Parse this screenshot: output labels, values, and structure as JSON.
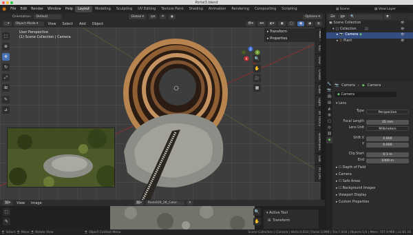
{
  "window": {
    "title": "Portal3.blend"
  },
  "topbar": {
    "menus": [
      "File",
      "Edit",
      "Render",
      "Window",
      "Help"
    ],
    "workspaces": [
      "Layout",
      "Modeling",
      "Sculpting",
      "UV Editing",
      "Texture Paint",
      "Shading",
      "Animation",
      "Rendering",
      "Compositing",
      "Scripting"
    ],
    "active_workspace": "Layout",
    "scene": "Scene",
    "view_layer": "View Layer"
  },
  "tool_header": {
    "orientation_label": "Orientation:",
    "orientation_value": "Default",
    "transform_orientation": "Global",
    "options": "Options"
  },
  "viewport_header": {
    "mode": "Object Mode",
    "menus": [
      "View",
      "Select",
      "Add",
      "Object"
    ]
  },
  "viewport": {
    "perspective": "User Perspective",
    "collection_info": "(1) Scene Collection | Camera",
    "nav_axes": [
      "X",
      "Y",
      "Z"
    ]
  },
  "npanel": {
    "transform": "Transform",
    "properties": "Properties",
    "tabs": [
      "Item",
      "Tool",
      "View",
      "Create",
      "Cube",
      "Sight",
      "BY TOOLS",
      "Bookmarks",
      "Edit",
      "MT DPS"
    ]
  },
  "outliner": {
    "title": "Scene Collection",
    "items": [
      {
        "name": "Collection",
        "level": 1,
        "selected": false
      },
      {
        "name": "Camera",
        "level": 2,
        "selected": true
      },
      {
        "name": "Plant",
        "level": 2,
        "selected": false
      }
    ]
  },
  "properties": {
    "breadcrumb_obj": "Camera",
    "breadcrumb_data": "Camera",
    "datablock": "Camera",
    "panel_lens": "Lens",
    "type_label": "Type",
    "type_value": "Perspective",
    "focal_label": "Focal Length",
    "focal_value": "35 mm",
    "lens_unit_label": "Lens Unit",
    "lens_unit_value": "Millimeters",
    "shift_x_label": "Shift X",
    "shift_x_value": "0.000",
    "shift_y_label": "Y",
    "shift_y_value": "0.000",
    "clip_start_label": "Clip Start",
    "clip_start_value": "0.1 m",
    "clip_end_label": "End",
    "clip_end_value": "1000 m",
    "panels": [
      "Depth of Field",
      "Camera",
      "Safe Areas",
      "Background Images",
      "Viewport Display",
      "Custom Properties"
    ]
  },
  "image_editor": {
    "menus": [
      "View",
      "Image"
    ],
    "image_name": "Rock020_2K_Color...",
    "active_tool": "Active Tool",
    "transform": "Transform"
  },
  "statusbar": {
    "left": [
      "Select",
      "Move",
      "Rotate View",
      "Object Context Menu"
    ],
    "right": "Scene Collection | Camera | Verts:4,018 | Faces:3,998 | Tris:7,918 | Objects:1/3 | Mem: 747.9 MiB | v2.81.16"
  },
  "colors": {
    "accent": "#4772b3",
    "axis_x": "#c03030",
    "axis_y": "#6e9a2e",
    "axis_z": "#3d6ad6"
  }
}
